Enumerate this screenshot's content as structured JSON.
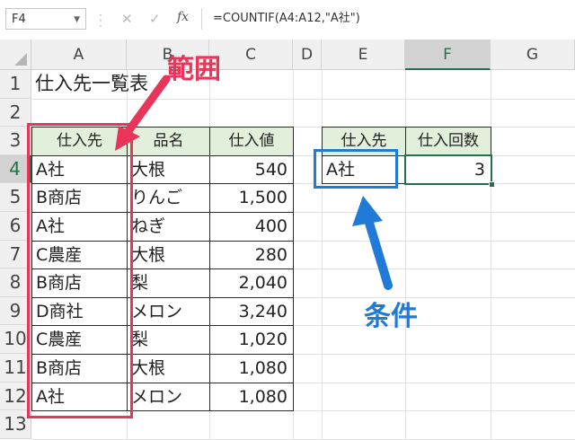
{
  "formula_bar": {
    "name_box": "F4",
    "cancel_symbol": "✕",
    "enter_symbol": "✓",
    "fx_label": "fx",
    "formula": "=COUNTIF(A4:A12,\"A社\")"
  },
  "columns": [
    "A",
    "B",
    "C",
    "D",
    "E",
    "F",
    "G"
  ],
  "selected_column": "F",
  "rows": [
    "1",
    "2",
    "3",
    "4",
    "5",
    "6",
    "7",
    "8",
    "9",
    "10",
    "11",
    "12",
    "13"
  ],
  "selected_row": "4",
  "sheet": {
    "title": "仕入先一覧表",
    "table_headers": [
      "仕入先",
      "品名",
      "仕入値"
    ],
    "table_rows": [
      [
        "A社",
        "大根",
        "540"
      ],
      [
        "B商店",
        "りんご",
        "1,500"
      ],
      [
        "A社",
        "ねぎ",
        "400"
      ],
      [
        "C農産",
        "大根",
        "280"
      ],
      [
        "B商店",
        "梨",
        "2,040"
      ],
      [
        "D商社",
        "メロン",
        "3,240"
      ],
      [
        "C農産",
        "梨",
        "1,020"
      ],
      [
        "B商店",
        "大根",
        "1,080"
      ],
      [
        "A社",
        "メロン",
        "1,080"
      ]
    ],
    "condition_headers": [
      "仕入先",
      "仕入回数"
    ],
    "condition_value": "A社",
    "result_value": "3"
  },
  "annotations": {
    "range_label": "範囲",
    "condition_label": "条件",
    "range_color": "#e8355a",
    "condition_color": "#1f7ad8"
  }
}
